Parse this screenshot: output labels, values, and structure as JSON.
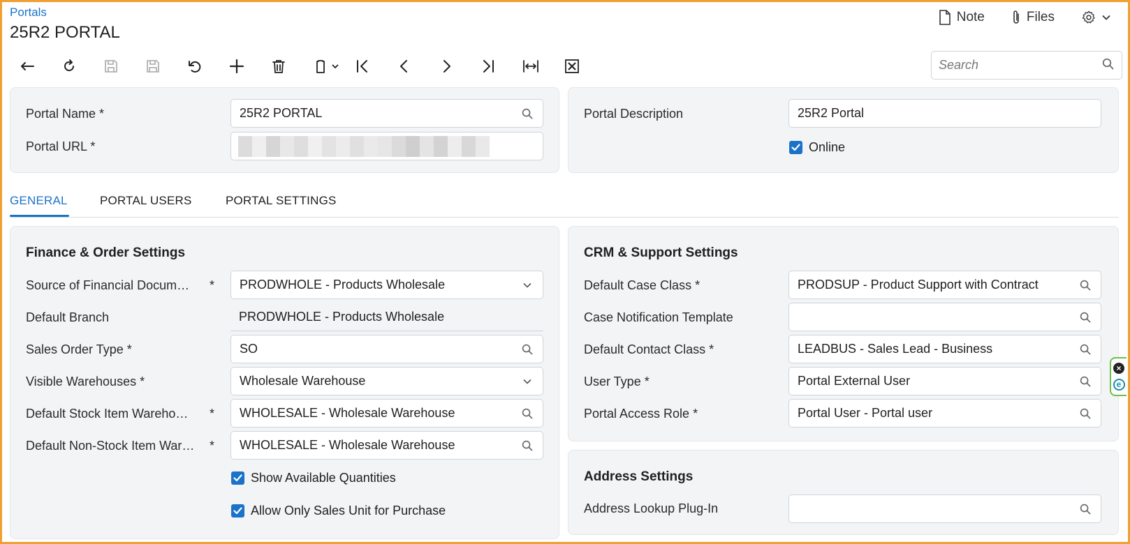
{
  "header": {
    "breadcrumb": "Portals",
    "title": "25R2 PORTAL",
    "note_label": "Note",
    "files_label": "Files"
  },
  "toolbar": {
    "buttons": [
      "back-icon",
      "refresh-icon",
      "save-close-icon",
      "save-icon",
      "undo-icon",
      "add-icon",
      "delete-icon",
      "copy-paste-icon",
      "first-icon",
      "previous-icon",
      "next-icon",
      "last-icon",
      "fit-width-icon",
      "export-excel-icon"
    ]
  },
  "search": {
    "placeholder": "Search"
  },
  "summary": {
    "portal_name_label": "Portal Name *",
    "portal_name_value": "25R2 PORTAL",
    "portal_url_label": "Portal URL *",
    "portal_description_label": "Portal Description",
    "portal_description_value": "25R2 Portal",
    "online_label": "Online",
    "online_checked": true
  },
  "tabs": [
    {
      "label": "GENERAL",
      "active": true
    },
    {
      "label": "PORTAL USERS",
      "active": false
    },
    {
      "label": "PORTAL SETTINGS",
      "active": false
    }
  ],
  "finance": {
    "title": "Finance & Order Settings",
    "source_label": "Source of Financial Docum…",
    "source_value": "PRODWHOLE - Products Wholesale",
    "branch_label": "Default Branch",
    "branch_value": "PRODWHOLE - Products Wholesale",
    "so_type_label": "Sales Order Type *",
    "so_type_value": "SO",
    "warehouses_label": "Visible Warehouses *",
    "warehouses_value": "Wholesale Warehouse",
    "stock_wh_label": "Default Stock Item Wareho…",
    "stock_wh_value": "WHOLESALE - Wholesale Warehouse",
    "nonstock_wh_label": "Default Non-Stock Item War…",
    "nonstock_wh_value": "WHOLESALE - Wholesale Warehouse",
    "show_qty_label": "Show Available Quantities",
    "sales_unit_label": "Allow Only Sales Unit for Purchase",
    "required_mark": "*"
  },
  "crm": {
    "title": "CRM & Support Settings",
    "case_class_label": "Default Case Class *",
    "case_class_value": "PRODSUP - Product Support with Contract",
    "case_notif_label": "Case Notification Template",
    "case_notif_value": "",
    "contact_class_label": "Default Contact Class *",
    "contact_class_value": "LEADBUS - Sales Lead - Business",
    "user_type_label": "User Type *",
    "user_type_value": "Portal External User",
    "access_role_label": "Portal Access Role *",
    "access_role_value": "Portal User - Portal user"
  },
  "address": {
    "title": "Address Settings",
    "lookup_label": "Address Lookup Plug-In",
    "lookup_value": ""
  },
  "colors": {
    "accent": "#1a73c8",
    "frame": "#f0a030",
    "panel": "#f3f4f6"
  }
}
